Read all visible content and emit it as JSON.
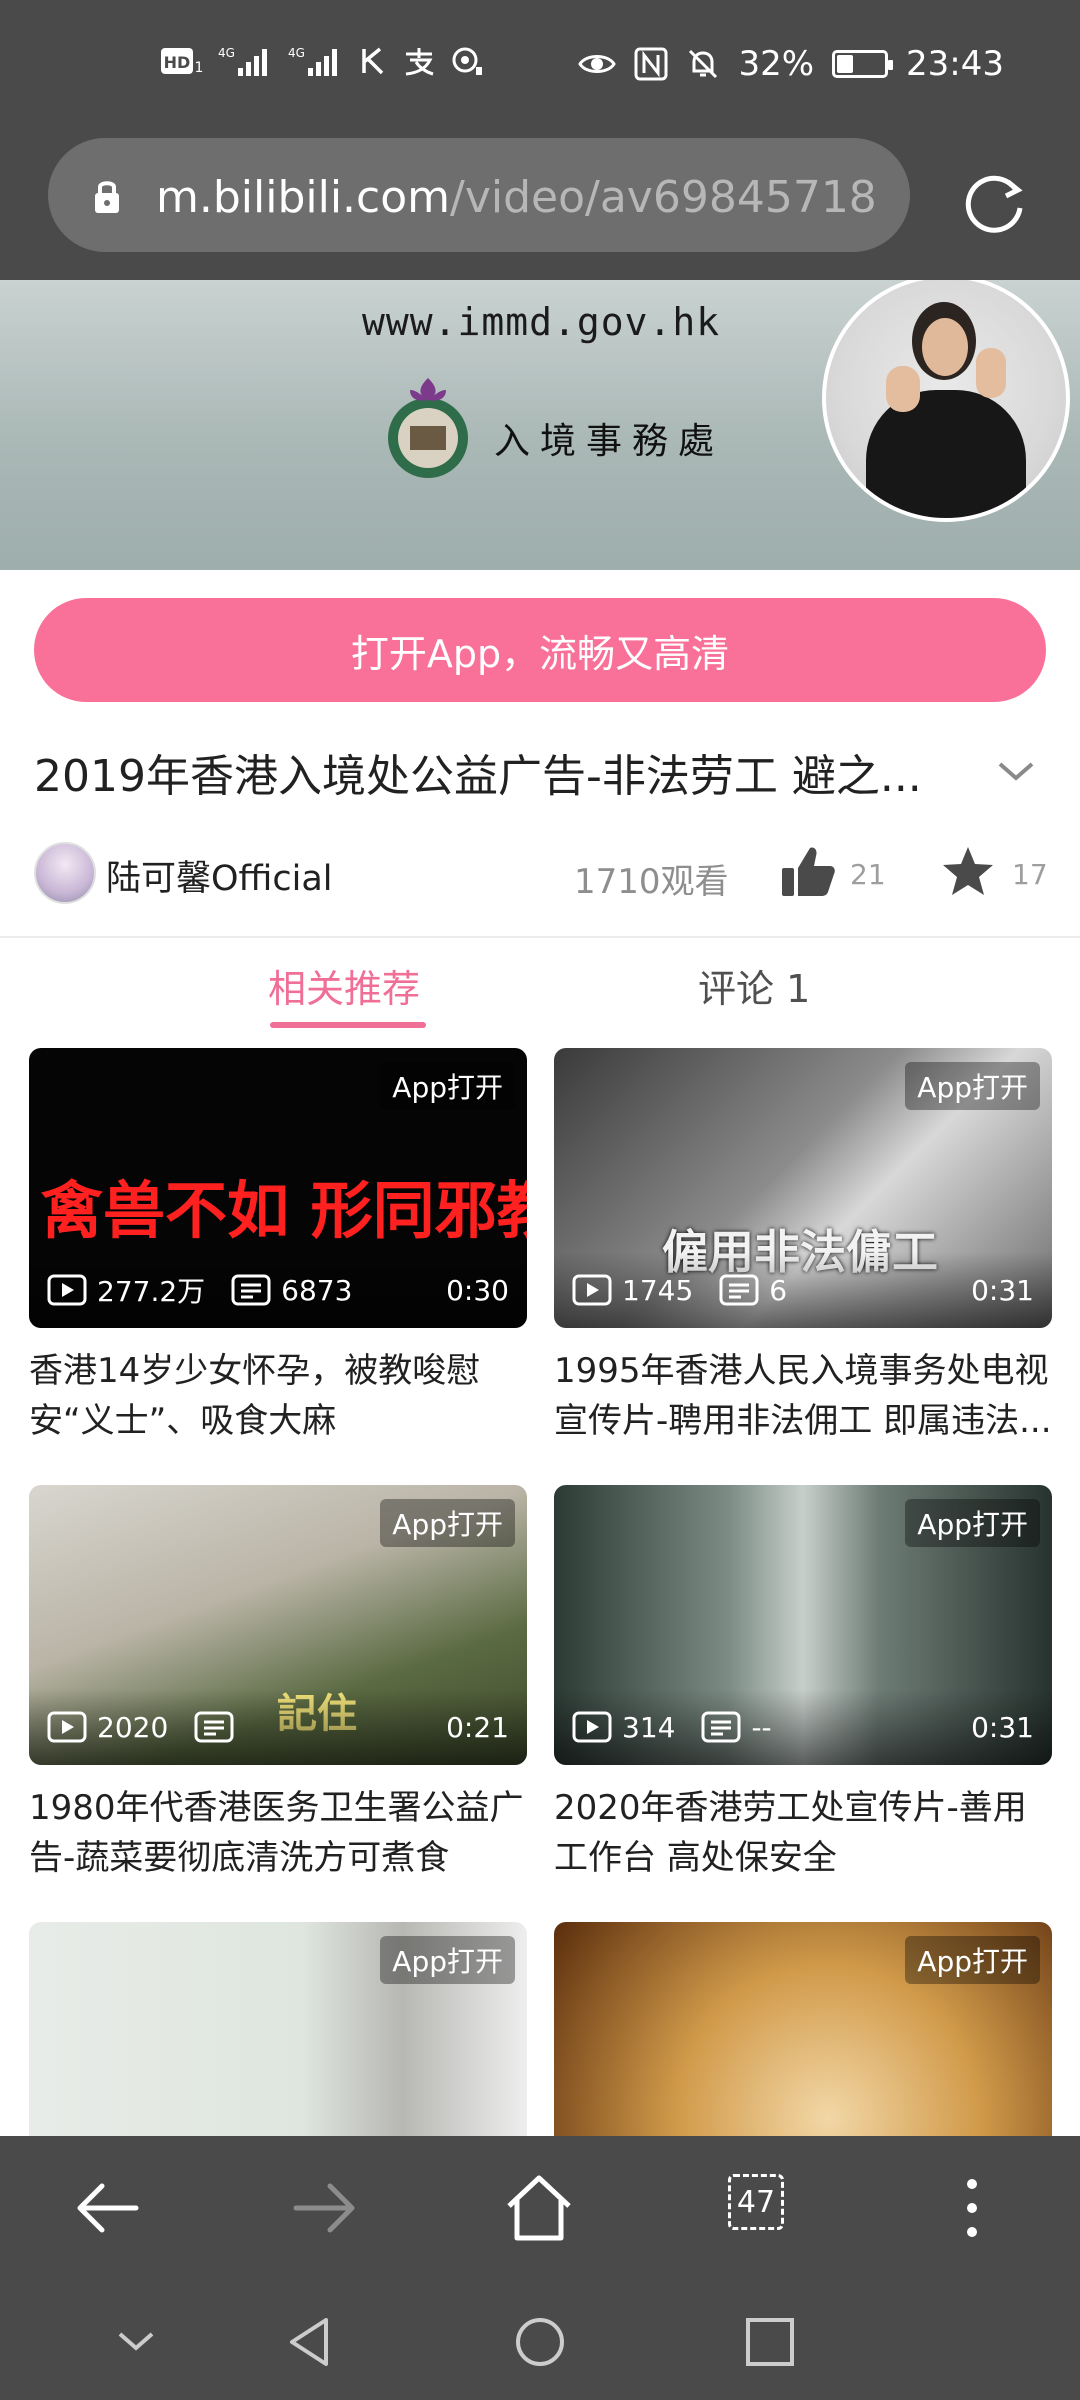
{
  "status_bar": {
    "left_icons": [
      "hd-icon",
      "signal-4g-icon",
      "signal-4g-icon",
      "k-icon",
      "alipay-icon",
      "sync-icon"
    ],
    "battery_percent": "32%",
    "battery_level": 0.32,
    "time": "23:43"
  },
  "browser": {
    "url_domain": "m.bilibili.com",
    "url_path": "/video/av69845718",
    "tab_count": "47"
  },
  "banner": {
    "url_text": "www.immd.gov.hk",
    "department": "入境事務處"
  },
  "open_app_button": "打开App，流畅又高清",
  "video": {
    "title": "2019年香港入境处公益广告-非法劳工 避之...",
    "uploader": "陆可馨Official",
    "views": "1710观看",
    "likes": "21",
    "favorites": "17"
  },
  "tabs": {
    "related": "相关推荐",
    "comments": "评论 1"
  },
  "cards": [
    {
      "app_open": "App打开",
      "plays": "277.2万",
      "danmaku": "6873",
      "duration": "0:30",
      "title": "香港14岁少女怀孕，被教唆慰安“义士”、吸食大麻",
      "overlay_text": "禽兽不如 形同邪教"
    },
    {
      "app_open": "App打开",
      "plays": "1745",
      "danmaku": "6",
      "duration": "0:31",
      "title": "1995年香港人民入境事务处电视宣传片-聘用非法佣工 即属违法...",
      "overlay_text": "僱用非法傭工"
    },
    {
      "app_open": "App打开",
      "plays": "2020",
      "danmaku": "",
      "duration": "0:21",
      "title": "1980年代香港医务卫生署公益广告-蔬菜要彻底清洗方可煮食",
      "overlay_text": "記住"
    },
    {
      "app_open": "App打开",
      "plays": "314",
      "danmaku": "--",
      "duration": "0:31",
      "title": "2020年香港劳工处宣传片-善用工作台 高处保安全",
      "overlay_text": ""
    },
    {
      "app_open": "App打开"
    },
    {
      "app_open": "App打开"
    }
  ],
  "colors": {
    "accent_pink": "#f97199",
    "tab_active": "#f06f97",
    "chrome_gray": "#4a4a4a"
  }
}
